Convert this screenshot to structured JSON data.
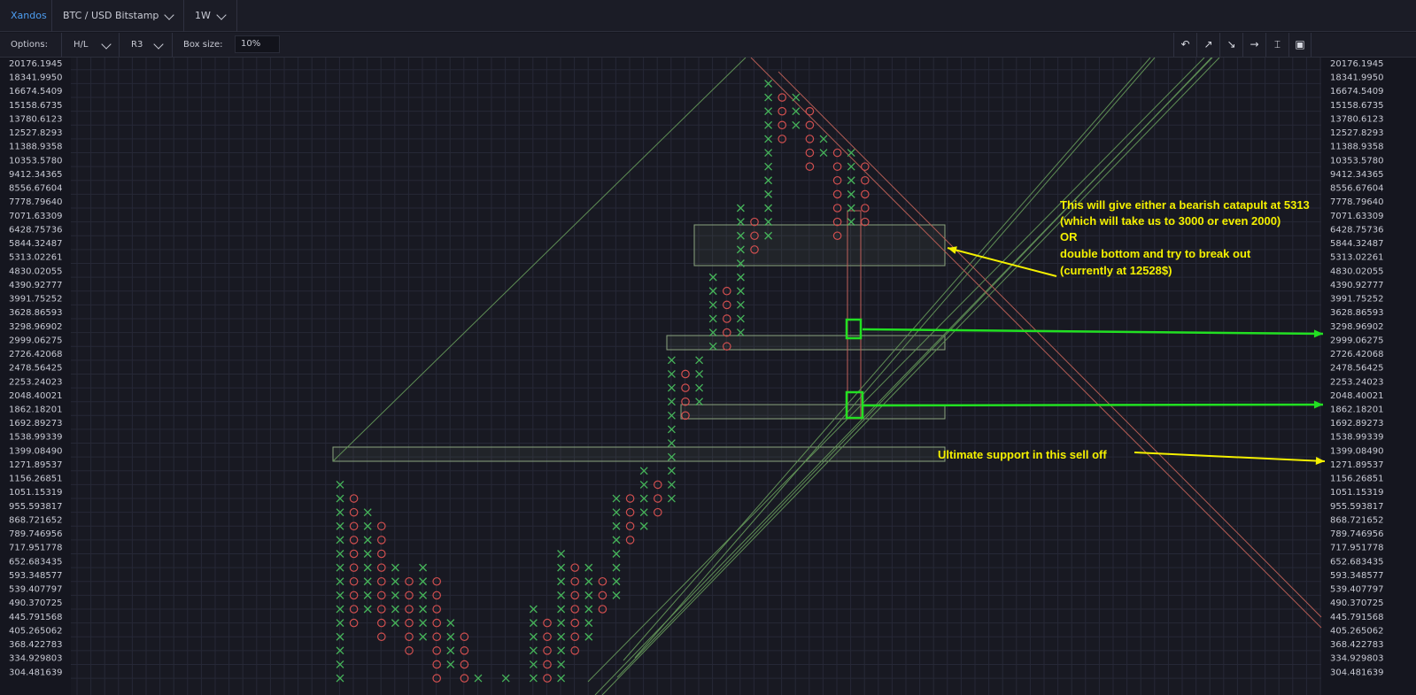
{
  "topbar": {
    "user": "Xandos",
    "symbol": "BTC / USD Bitstamp",
    "resolution": "1W"
  },
  "options": {
    "label": "Options:",
    "source": "H/L",
    "reversal": "R3",
    "box_size_label": "Box size:",
    "box_size_value": "10%",
    "tools": [
      "undo-icon",
      "ray-up-icon",
      "ray-down-icon",
      "horizontal-ray-icon",
      "measure-icon",
      "screenshot-icon"
    ]
  },
  "colors": {
    "x_color": "#46b45a",
    "o_color": "#d14f4f",
    "trendline_green": "#5f8f55",
    "trendline_red": "#b45c54",
    "annotation": "#f4f000",
    "marker_green": "#22e022"
  },
  "chart_data": {
    "type": "point-and-figure",
    "box_size": "10%",
    "reversal": 3,
    "price_levels": [
      "20176.1945",
      "18341.9950",
      "16674.5409",
      "15158.6735",
      "13780.6123",
      "12527.8293",
      "11388.9358",
      "10353.5780",
      "9412.34365",
      "8556.67604",
      "7778.79640",
      "7071.63309",
      "6428.75736",
      "5844.32487",
      "5313.02261",
      "4830.02055",
      "4390.92777",
      "3991.75252",
      "3628.86593",
      "3298.96902",
      "2999.06275",
      "2726.42068",
      "2478.56425",
      "2253.24023",
      "2048.40021",
      "1862.18201",
      "1692.89273",
      "1538.99339",
      "1399.08490",
      "1271.89537",
      "1156.26851",
      "1051.15319",
      "955.593817",
      "868.721652",
      "789.746956",
      "717.951778",
      "652.683435",
      "593.348577",
      "539.407797",
      "490.370725",
      "445.791568",
      "405.265062",
      "368.422783",
      "334.929803",
      "304.481639"
    ],
    "columns": [
      {
        "col": 0,
        "type": "X",
        "from": "304.481639",
        "to": "1156.26851"
      },
      {
        "col": 1,
        "type": "O",
        "from": "1051.15319",
        "to": "445.791568"
      },
      {
        "col": 2,
        "type": "X",
        "from": "490.370725",
        "to": "955.593817"
      },
      {
        "col": 3,
        "type": "O",
        "from": "868.721652",
        "to": "405.265062"
      },
      {
        "col": 4,
        "type": "X",
        "from": "445.791568",
        "to": "652.683435"
      },
      {
        "col": 5,
        "type": "O",
        "from": "593.348577",
        "to": "368.422783"
      },
      {
        "col": 6,
        "type": "X",
        "from": "405.265062",
        "to": "652.683435"
      },
      {
        "col": 7,
        "type": "O",
        "from": "593.348577",
        "to": "304.481639"
      },
      {
        "col": 8,
        "type": "X",
        "from": "334.929803",
        "to": "445.791568"
      },
      {
        "col": 9,
        "type": "O",
        "from": "405.265062",
        "to": "304.481639"
      },
      {
        "col": 10,
        "type": "X",
        "from": "304.481639",
        "to": "304.481639"
      },
      {
        "col": 12,
        "type": "X",
        "from": "304.481639",
        "to": "304.481639"
      },
      {
        "col": 14,
        "type": "X",
        "from": "304.481639",
        "to": "490.370725"
      },
      {
        "col": 15,
        "type": "O",
        "from": "445.791568",
        "to": "304.481639"
      },
      {
        "col": 16,
        "type": "X",
        "from": "304.481639",
        "to": "717.951778"
      },
      {
        "col": 17,
        "type": "O",
        "from": "652.683435",
        "to": "368.422783"
      },
      {
        "col": 18,
        "type": "X",
        "from": "405.265062",
        "to": "652.683435"
      },
      {
        "col": 19,
        "type": "O",
        "from": "593.348577",
        "to": "490.370725"
      },
      {
        "col": 20,
        "type": "X",
        "from": "539.407797",
        "to": "1051.15319"
      },
      {
        "col": 21,
        "type": "O",
        "from": "1051.15319",
        "to": "789.746956"
      },
      {
        "col": 22,
        "type": "X",
        "from": "868.721652",
        "to": "1271.89537"
      },
      {
        "col": 23,
        "type": "O",
        "from": "1156.26851",
        "to": "955.593817"
      },
      {
        "col": 24,
        "type": "X",
        "from": "1051.15319",
        "to": "2726.42068"
      },
      {
        "col": 25,
        "type": "O",
        "from": "2478.56425",
        "to": "1862.18201"
      },
      {
        "col": 26,
        "type": "X",
        "from": "2048.40021",
        "to": "2726.42068"
      },
      {
        "col": 27,
        "type": "X",
        "from": "2999.06275",
        "to": "4830.02055"
      },
      {
        "col": 28,
        "type": "O",
        "from": "4390.92777",
        "to": "2999.06275"
      },
      {
        "col": 29,
        "type": "X",
        "from": "3298.96902",
        "to": "7778.79640"
      },
      {
        "col": 30,
        "type": "O",
        "from": "7071.63309",
        "to": "5844.32487"
      },
      {
        "col": 31,
        "type": "X",
        "from": "6428.75736",
        "to": "18341.9950"
      },
      {
        "col": 32,
        "type": "O",
        "from": "16674.5409",
        "to": "12527.8293"
      },
      {
        "col": 33,
        "type": "X",
        "from": "13780.6123",
        "to": "16674.5409"
      },
      {
        "col": 34,
        "type": "O",
        "from": "15158.6735",
        "to": "10353.5780"
      },
      {
        "col": 35,
        "type": "X",
        "from": "11388.9358",
        "to": "12527.8293"
      },
      {
        "col": 36,
        "type": "O",
        "from": "11388.9358",
        "to": "6428.75736"
      },
      {
        "col": 37,
        "type": "X",
        "from": "7071.63309",
        "to": "11388.9358"
      },
      {
        "col": 38,
        "type": "O",
        "from": "10353.5780",
        "to": "7071.63309"
      }
    ],
    "annotations": [
      "This will give either a bearish catapult at 5313",
      "(which will take us to 3000 or even 2000)",
      "OR",
      "double bottom and try to break out",
      "(currently at 12528$)",
      "Ultimate support in this sell off"
    ]
  }
}
